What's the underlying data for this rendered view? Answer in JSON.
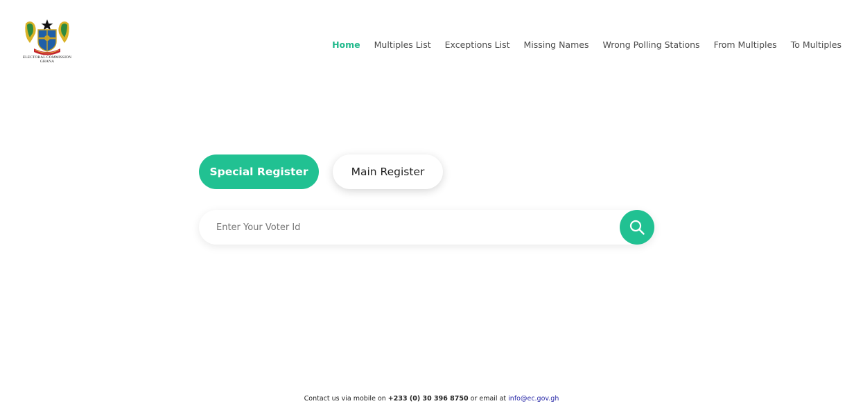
{
  "brand": {
    "logo_line1": "ELECTORAL COMMISSION",
    "logo_line2": "GHANA"
  },
  "nav": {
    "items": [
      {
        "label": "Home",
        "active": true
      },
      {
        "label": "Multiples List"
      },
      {
        "label": "Exceptions List"
      },
      {
        "label": "Missing Names"
      },
      {
        "label": "Wrong Polling Stations"
      },
      {
        "label": "From Multiples"
      },
      {
        "label": "To Multiples"
      }
    ]
  },
  "toggle": {
    "special_label": "Special Register",
    "main_label": "Main Register",
    "selected": "Special Register"
  },
  "search": {
    "placeholder": "Enter Your Voter Id",
    "value": "",
    "icon": "search-icon"
  },
  "footer": {
    "prefix": "Contact us via mobile on ",
    "phone": "+233 (0) 30 396 8750",
    "middle": " or email at ",
    "email": "info@ec.gov.gh"
  },
  "colors": {
    "accent": "#21c192",
    "nav_active": "#21b98c",
    "email_link": "#2a2aa8"
  }
}
